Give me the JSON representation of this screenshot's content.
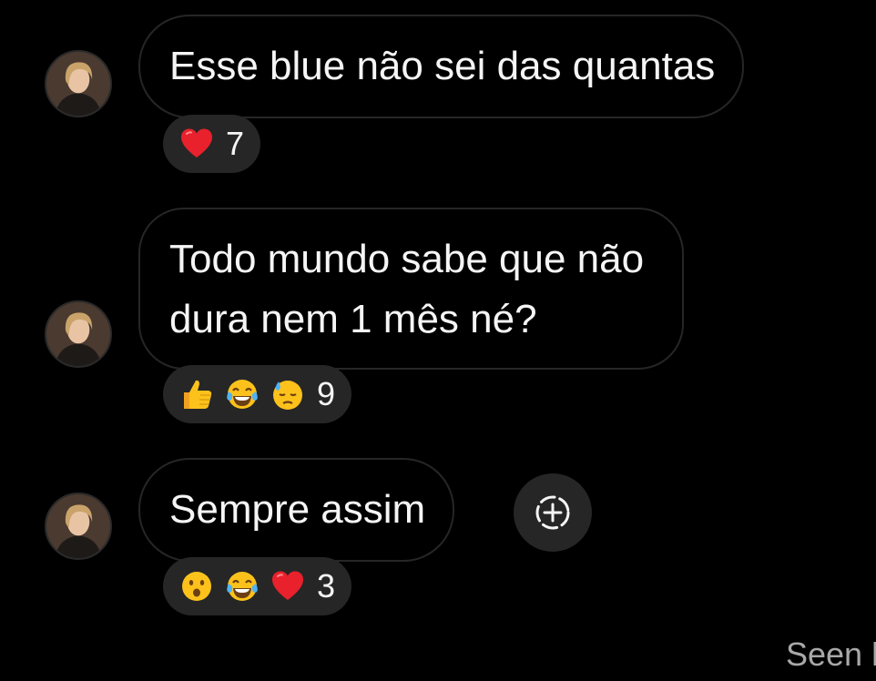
{
  "messages": [
    {
      "text": "Esse blue não sei das quantas",
      "reactions": {
        "emojis": [
          "red-heart"
        ],
        "count": "7"
      }
    },
    {
      "lines": [
        "Todo mundo sabe que não",
        "dura nem 1 mês né?"
      ],
      "reactions": {
        "emojis": [
          "thumbs-up",
          "face-with-tears-of-joy",
          "downcast-face-with-sweat"
        ],
        "count": "9"
      }
    },
    {
      "text": "Sempre assim",
      "reactions": {
        "emojis": [
          "hushed-face",
          "face-with-tears-of-joy",
          "red-heart"
        ],
        "count": "3"
      }
    }
  ],
  "status": {
    "seen": "Seen l"
  },
  "colors": {
    "background": "#000000",
    "bubble_border": "#262626",
    "reaction_pill": "#262626",
    "text": "#f5f5f5",
    "seen_text": "#a8a8a8"
  }
}
